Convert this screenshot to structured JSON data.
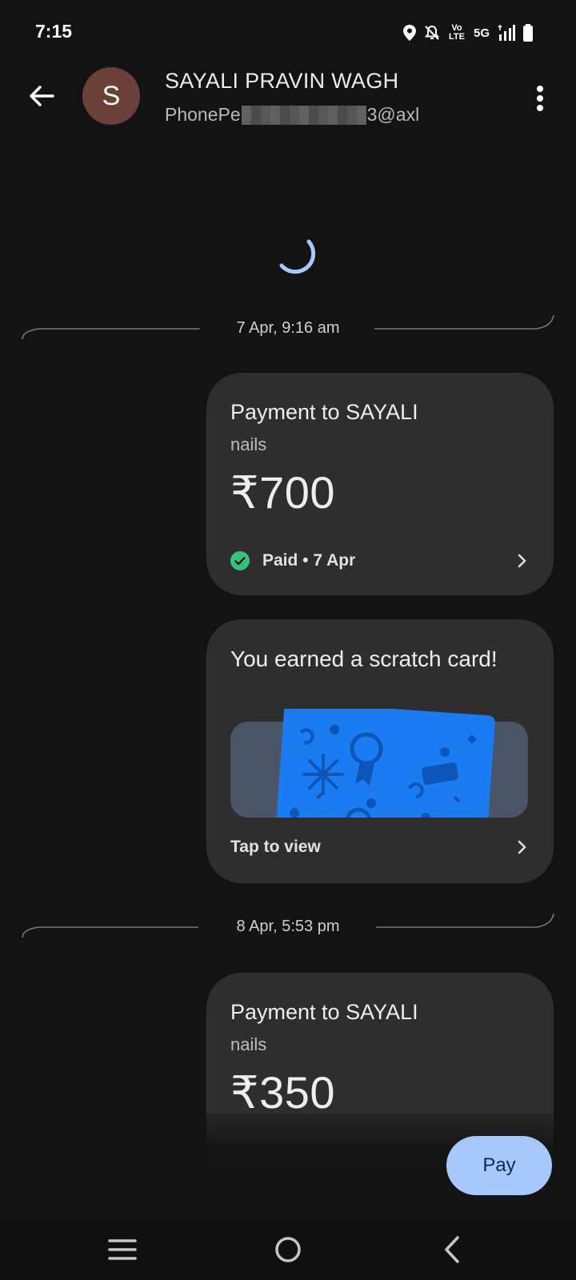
{
  "status_bar": {
    "time": "7:15",
    "network": "5G",
    "volte": "Vo LTE",
    "icons": [
      "location-icon",
      "bell-off-icon",
      "volte-icon",
      "signal-icon",
      "battery-icon"
    ]
  },
  "header": {
    "avatar_letter": "S",
    "name": "SAYALI PRAVIN WAGH",
    "upi_prefix": "PhonePe",
    "upi_suffix": "3@axl",
    "icons": [
      "back-arrow-icon",
      "more-vert-icon"
    ]
  },
  "separators": [
    {
      "label": "7 Apr, 9:16 am"
    },
    {
      "label": "8 Apr, 5:53 pm"
    }
  ],
  "payments": [
    {
      "title": "Payment to SAYALI",
      "note": "nails",
      "amount": "₹700",
      "status": "Paid • 7 Apr"
    },
    {
      "title": "Payment to SAYALI",
      "note": "nails",
      "amount": "₹350"
    }
  ],
  "scratch_card": {
    "title": "You earned a scratch card!",
    "cta": "Tap to view"
  },
  "pay_button": {
    "label": "Pay"
  },
  "colors": {
    "background": "#131313",
    "card": "#2e2e2e",
    "accent": "#a8c7fa",
    "paid_green": "#34c37a",
    "scratch_blue": "#1b7cf2",
    "avatar": "#6b4037"
  }
}
